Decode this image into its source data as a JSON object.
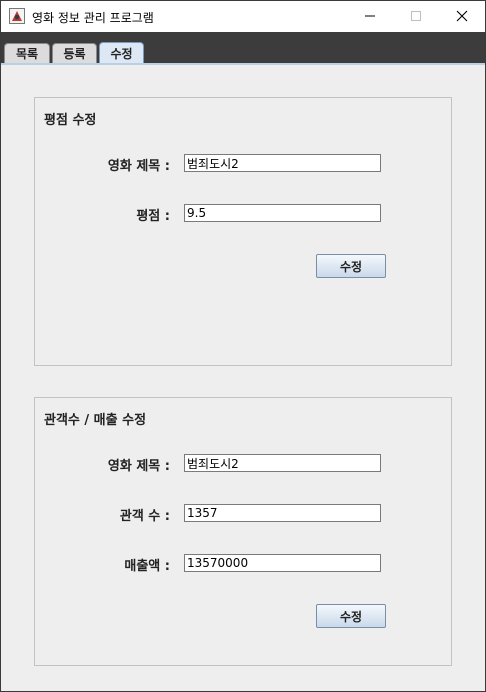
{
  "window": {
    "title": "영화 정보 관리 프로그램",
    "minimize_glyph": "—",
    "maximize_glyph": "☐",
    "close_glyph": "✕"
  },
  "tabs": [
    {
      "label": "목록",
      "active": false
    },
    {
      "label": "등록",
      "active": false
    },
    {
      "label": "수정",
      "active": true
    }
  ],
  "rating_panel": {
    "title": "평점 수정",
    "movie_title_label": "영화 제목 :",
    "movie_title_value": "범죄도시2",
    "rating_label": "평점 :",
    "rating_value": "9.5",
    "submit_label": "수정"
  },
  "audience_panel": {
    "title": "관객수 / 매출 수정",
    "movie_title_label": "영화 제목 :",
    "movie_title_value": "범죄도시2",
    "audience_label": "관객 수 :",
    "audience_value": "1357",
    "revenue_label": "매출액 :",
    "revenue_value": "13570000",
    "submit_label": "수정"
  },
  "colors": {
    "tabstrip_bg": "#3c3c3c",
    "active_tab_bg": "#dde8f4",
    "content_bg": "#eeeeee"
  }
}
